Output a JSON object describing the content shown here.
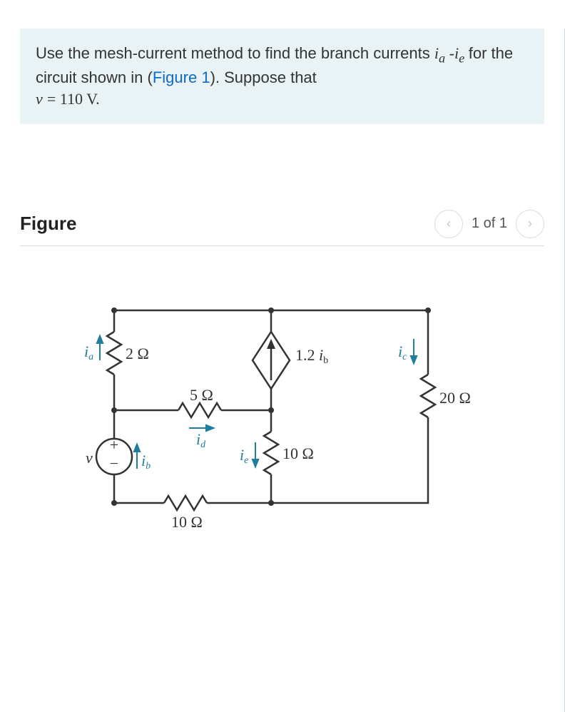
{
  "prompt": {
    "text_before_link": "Use the mesh-current method to find the branch currents ",
    "vars": "iₐ - i",
    "vars_sub": "e",
    "text_mid": " for the circuit shown in (",
    "link_text": "Figure 1",
    "text_after_link": "). Suppose that ",
    "equation": "v = 110 V."
  },
  "figure": {
    "heading": "Figure",
    "counter": "1 of 1",
    "prev_aria": "previous figure",
    "next_aria": "next figure"
  },
  "circuit": {
    "labels": {
      "ia": "iₐ",
      "ib": "ib",
      "ic": "ic",
      "id": "id",
      "ie": "ie",
      "r2": "2 Ω",
      "r5": "5 Ω",
      "r10_bottom": "10 Ω",
      "r10_right": "10 Ω",
      "r20": "20 Ω",
      "dep_src": "1.2 ib",
      "vsrc": "v",
      "plus": "+",
      "minus": "−"
    }
  }
}
